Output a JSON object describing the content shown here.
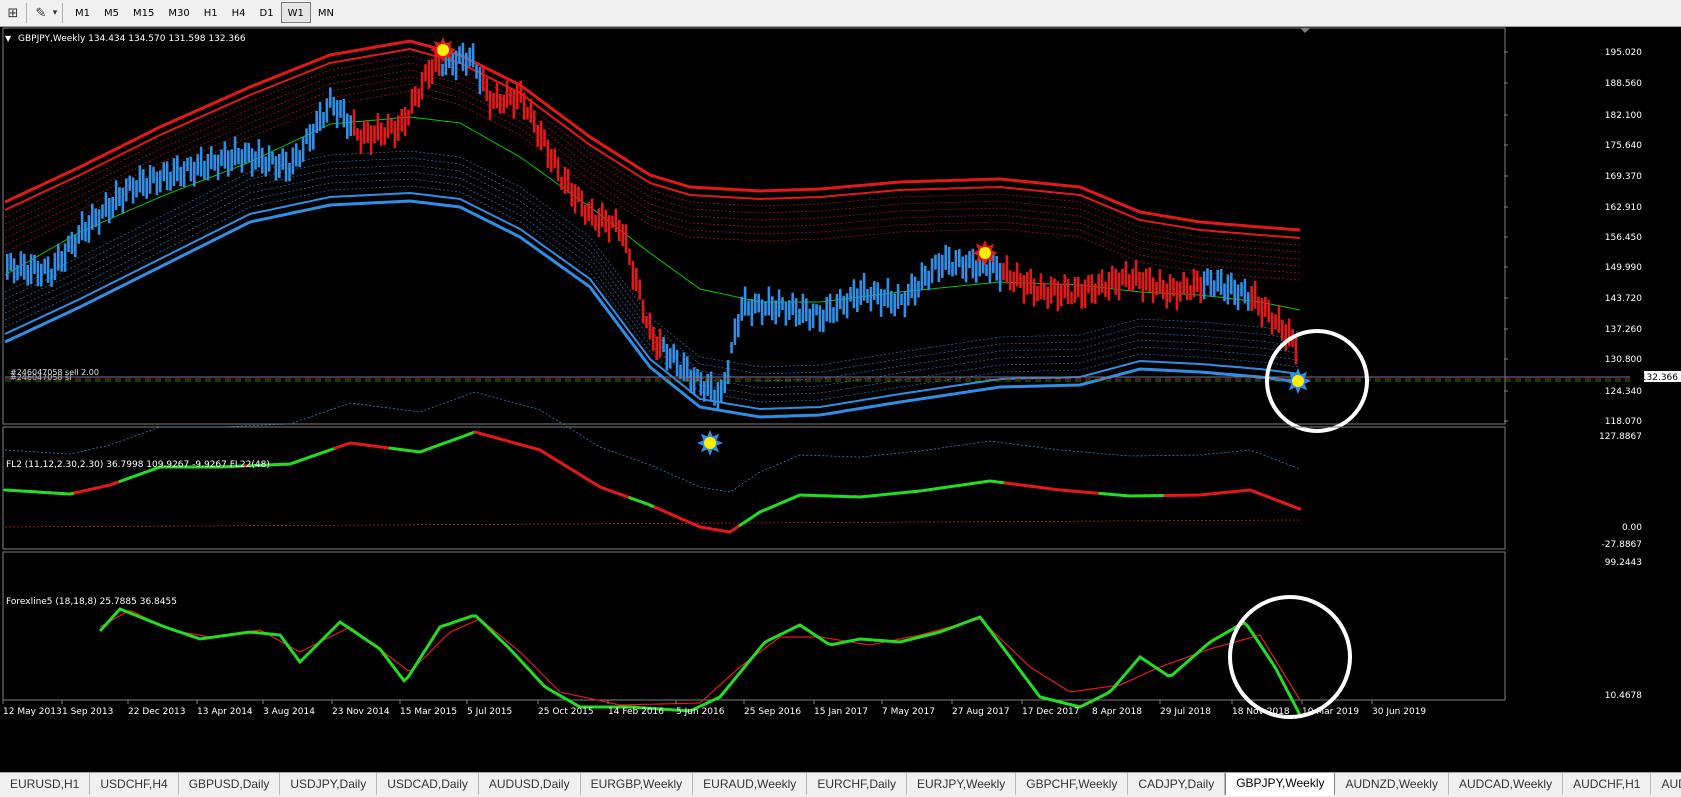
{
  "toolbar": {
    "timeframes": [
      "M1",
      "M5",
      "M15",
      "M30",
      "H1",
      "H4",
      "D1",
      "W1",
      "MN"
    ],
    "active_timeframe": "W1"
  },
  "main_panel": {
    "header": "GBPJPY,Weekly  134.434 134.570 131.598 132.366",
    "price_labels": [
      "195.020",
      "188.560",
      "182.100",
      "175.640",
      "169.370",
      "162.910",
      "156.450",
      "149.990",
      "143.720",
      "137.260",
      "130.800",
      "124.340",
      "118.070"
    ],
    "current_price": "132.366",
    "order_label_1": "#246047058 sell 2.00",
    "order_label_2": "#246047058 sl"
  },
  "fl2_panel": {
    "header": "FL2 (11,12,2.30,2.30) 36.7998 109.9267 -9.9267  FL22(48)",
    "scale_labels": [
      "127.8867",
      "0.00",
      "-27.8867"
    ]
  },
  "forexline_panel": {
    "header": "Forexline5 (18,18,8) 25.7885 36.8455",
    "scale_labels": [
      "99.2443",
      "10.4678"
    ]
  },
  "date_labels": [
    "12 May 2013",
    "1 Sep 2013",
    "22 Dec 2013",
    "13 Apr 2014",
    "3 Aug 2014",
    "23 Nov 2014",
    "15 Mar 2015",
    "5 Jul 2015",
    "25 Oct 2015",
    "14 Feb 2016",
    "5 Jun 2016",
    "25 Sep 2016",
    "15 Jan 2017",
    "7 May 2017",
    "27 Aug 2017",
    "17 Dec 2017",
    "8 Apr 2018",
    "29 Jul 2018",
    "18 Nov 2018",
    "10 Mar 2019",
    "30 Jun 2019"
  ],
  "tabs": [
    "EURUSD,H1",
    "USDCHF,H4",
    "GBPUSD,Daily",
    "USDJPY,Daily",
    "USDCAD,Daily",
    "AUDUSD,Daily",
    "EURGBP,Weekly",
    "EURAUD,Weekly",
    "EURCHF,Daily",
    "EURJPY,Weekly",
    "GBPCHF,Weekly",
    "CADJPY,Daily",
    "GBPJPY,Weekly",
    "AUDNZD,Weekly",
    "AUDCAD,Weekly",
    "AUDCHF,H1",
    "AUDJPY,D"
  ],
  "active_tab": "GBPJPY,Weekly",
  "colors": {
    "bull": "#2f8fe6",
    "bear": "#e31919",
    "green_line": "#00c800",
    "osc_green": "#22dd22",
    "background": "#000000"
  }
}
